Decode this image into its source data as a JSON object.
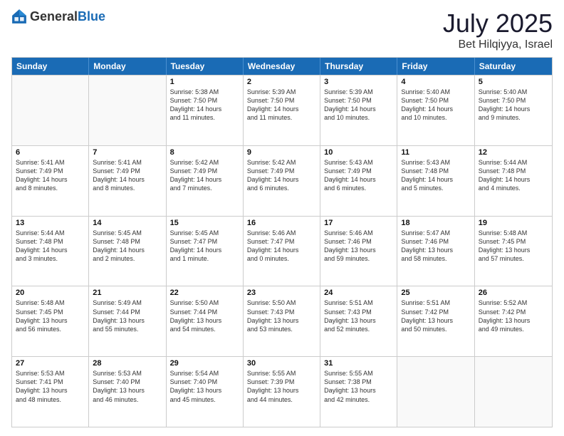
{
  "header": {
    "logo_general": "General",
    "logo_blue": "Blue",
    "month": "July 2025",
    "location": "Bet Hilqiyya, Israel"
  },
  "weekdays": [
    "Sunday",
    "Monday",
    "Tuesday",
    "Wednesday",
    "Thursday",
    "Friday",
    "Saturday"
  ],
  "rows": [
    [
      {
        "day": "",
        "lines": []
      },
      {
        "day": "",
        "lines": []
      },
      {
        "day": "1",
        "lines": [
          "Sunrise: 5:38 AM",
          "Sunset: 7:50 PM",
          "Daylight: 14 hours",
          "and 11 minutes."
        ]
      },
      {
        "day": "2",
        "lines": [
          "Sunrise: 5:39 AM",
          "Sunset: 7:50 PM",
          "Daylight: 14 hours",
          "and 11 minutes."
        ]
      },
      {
        "day": "3",
        "lines": [
          "Sunrise: 5:39 AM",
          "Sunset: 7:50 PM",
          "Daylight: 14 hours",
          "and 10 minutes."
        ]
      },
      {
        "day": "4",
        "lines": [
          "Sunrise: 5:40 AM",
          "Sunset: 7:50 PM",
          "Daylight: 14 hours",
          "and 10 minutes."
        ]
      },
      {
        "day": "5",
        "lines": [
          "Sunrise: 5:40 AM",
          "Sunset: 7:50 PM",
          "Daylight: 14 hours",
          "and 9 minutes."
        ]
      }
    ],
    [
      {
        "day": "6",
        "lines": [
          "Sunrise: 5:41 AM",
          "Sunset: 7:49 PM",
          "Daylight: 14 hours",
          "and 8 minutes."
        ]
      },
      {
        "day": "7",
        "lines": [
          "Sunrise: 5:41 AM",
          "Sunset: 7:49 PM",
          "Daylight: 14 hours",
          "and 8 minutes."
        ]
      },
      {
        "day": "8",
        "lines": [
          "Sunrise: 5:42 AM",
          "Sunset: 7:49 PM",
          "Daylight: 14 hours",
          "and 7 minutes."
        ]
      },
      {
        "day": "9",
        "lines": [
          "Sunrise: 5:42 AM",
          "Sunset: 7:49 PM",
          "Daylight: 14 hours",
          "and 6 minutes."
        ]
      },
      {
        "day": "10",
        "lines": [
          "Sunrise: 5:43 AM",
          "Sunset: 7:49 PM",
          "Daylight: 14 hours",
          "and 6 minutes."
        ]
      },
      {
        "day": "11",
        "lines": [
          "Sunrise: 5:43 AM",
          "Sunset: 7:48 PM",
          "Daylight: 14 hours",
          "and 5 minutes."
        ]
      },
      {
        "day": "12",
        "lines": [
          "Sunrise: 5:44 AM",
          "Sunset: 7:48 PM",
          "Daylight: 14 hours",
          "and 4 minutes."
        ]
      }
    ],
    [
      {
        "day": "13",
        "lines": [
          "Sunrise: 5:44 AM",
          "Sunset: 7:48 PM",
          "Daylight: 14 hours",
          "and 3 minutes."
        ]
      },
      {
        "day": "14",
        "lines": [
          "Sunrise: 5:45 AM",
          "Sunset: 7:48 PM",
          "Daylight: 14 hours",
          "and 2 minutes."
        ]
      },
      {
        "day": "15",
        "lines": [
          "Sunrise: 5:45 AM",
          "Sunset: 7:47 PM",
          "Daylight: 14 hours",
          "and 1 minute."
        ]
      },
      {
        "day": "16",
        "lines": [
          "Sunrise: 5:46 AM",
          "Sunset: 7:47 PM",
          "Daylight: 14 hours",
          "and 0 minutes."
        ]
      },
      {
        "day": "17",
        "lines": [
          "Sunrise: 5:46 AM",
          "Sunset: 7:46 PM",
          "Daylight: 13 hours",
          "and 59 minutes."
        ]
      },
      {
        "day": "18",
        "lines": [
          "Sunrise: 5:47 AM",
          "Sunset: 7:46 PM",
          "Daylight: 13 hours",
          "and 58 minutes."
        ]
      },
      {
        "day": "19",
        "lines": [
          "Sunrise: 5:48 AM",
          "Sunset: 7:45 PM",
          "Daylight: 13 hours",
          "and 57 minutes."
        ]
      }
    ],
    [
      {
        "day": "20",
        "lines": [
          "Sunrise: 5:48 AM",
          "Sunset: 7:45 PM",
          "Daylight: 13 hours",
          "and 56 minutes."
        ]
      },
      {
        "day": "21",
        "lines": [
          "Sunrise: 5:49 AM",
          "Sunset: 7:44 PM",
          "Daylight: 13 hours",
          "and 55 minutes."
        ]
      },
      {
        "day": "22",
        "lines": [
          "Sunrise: 5:50 AM",
          "Sunset: 7:44 PM",
          "Daylight: 13 hours",
          "and 54 minutes."
        ]
      },
      {
        "day": "23",
        "lines": [
          "Sunrise: 5:50 AM",
          "Sunset: 7:43 PM",
          "Daylight: 13 hours",
          "and 53 minutes."
        ]
      },
      {
        "day": "24",
        "lines": [
          "Sunrise: 5:51 AM",
          "Sunset: 7:43 PM",
          "Daylight: 13 hours",
          "and 52 minutes."
        ]
      },
      {
        "day": "25",
        "lines": [
          "Sunrise: 5:51 AM",
          "Sunset: 7:42 PM",
          "Daylight: 13 hours",
          "and 50 minutes."
        ]
      },
      {
        "day": "26",
        "lines": [
          "Sunrise: 5:52 AM",
          "Sunset: 7:42 PM",
          "Daylight: 13 hours",
          "and 49 minutes."
        ]
      }
    ],
    [
      {
        "day": "27",
        "lines": [
          "Sunrise: 5:53 AM",
          "Sunset: 7:41 PM",
          "Daylight: 13 hours",
          "and 48 minutes."
        ]
      },
      {
        "day": "28",
        "lines": [
          "Sunrise: 5:53 AM",
          "Sunset: 7:40 PM",
          "Daylight: 13 hours",
          "and 46 minutes."
        ]
      },
      {
        "day": "29",
        "lines": [
          "Sunrise: 5:54 AM",
          "Sunset: 7:40 PM",
          "Daylight: 13 hours",
          "and 45 minutes."
        ]
      },
      {
        "day": "30",
        "lines": [
          "Sunrise: 5:55 AM",
          "Sunset: 7:39 PM",
          "Daylight: 13 hours",
          "and 44 minutes."
        ]
      },
      {
        "day": "31",
        "lines": [
          "Sunrise: 5:55 AM",
          "Sunset: 7:38 PM",
          "Daylight: 13 hours",
          "and 42 minutes."
        ]
      },
      {
        "day": "",
        "lines": []
      },
      {
        "day": "",
        "lines": []
      }
    ]
  ]
}
